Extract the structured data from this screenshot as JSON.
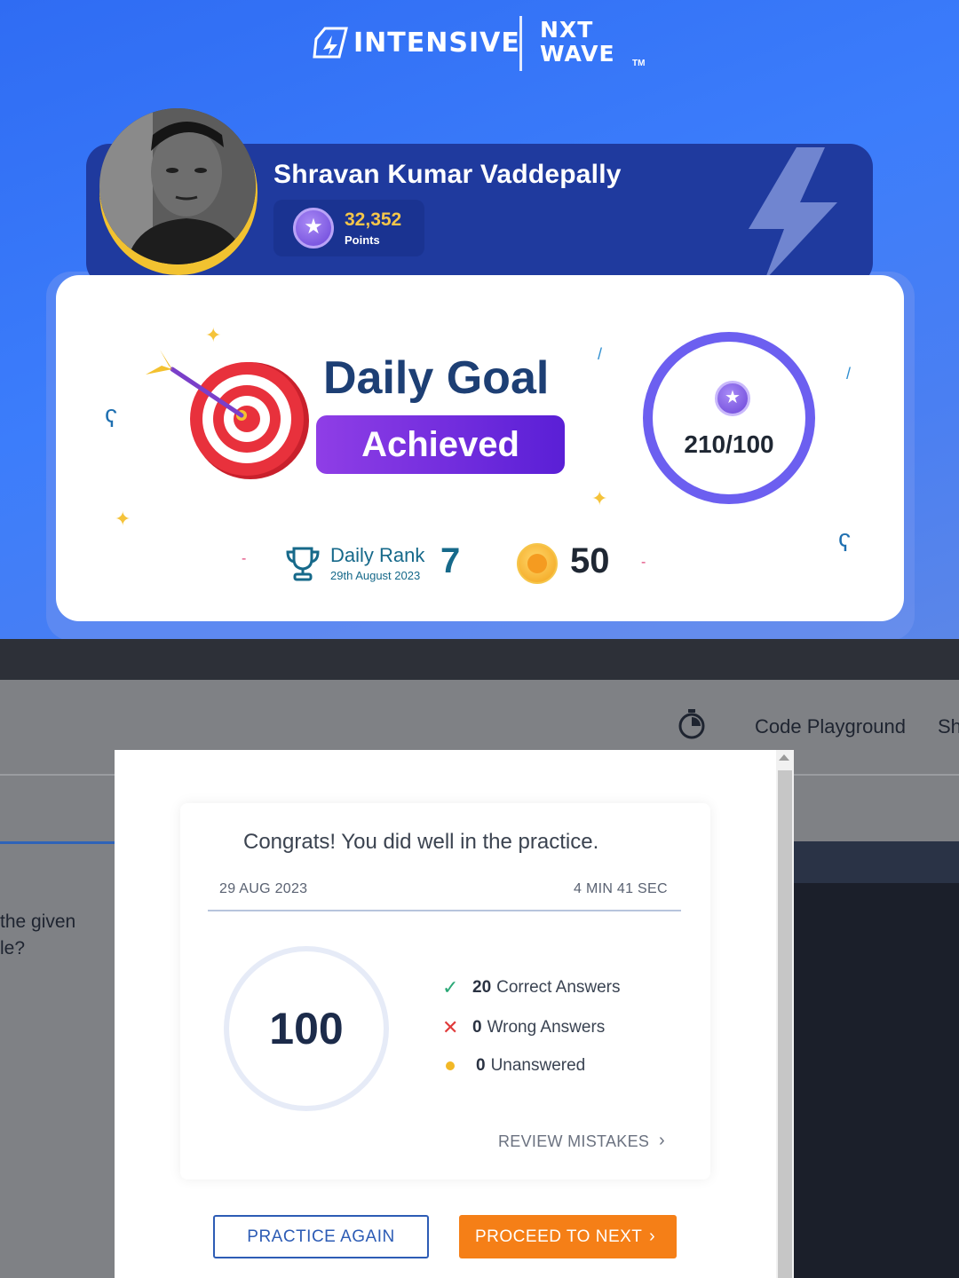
{
  "brand": {
    "left_name": "INTENSIVE",
    "right_line1": "NXT",
    "right_line2": "WAVE",
    "tm": "TM"
  },
  "profile": {
    "name": "Shravan Kumar Vaddepally",
    "points_value": "32,352",
    "points_label": "Points"
  },
  "daily_goal": {
    "title": "Daily Goal",
    "status": "Achieved",
    "progress": "210/100",
    "progress_fraction": 2.1,
    "rank_label": "Daily Rank",
    "rank_date": "29th August 2023",
    "rank_value": "7",
    "coins": "50"
  },
  "app": {
    "code_playground": "Code Playground",
    "partial_tab": "Sh",
    "question_line1": "the given",
    "question_line2": "le?"
  },
  "result": {
    "heading": "Congrats! You did well in the practice.",
    "date": "29 AUG 2023",
    "duration": "4 MIN 41 SEC",
    "score": "100",
    "correct_count": "20",
    "correct_label": "Correct Answers",
    "wrong_count": "0",
    "wrong_label": "Wrong Answers",
    "unanswered_count": "0",
    "unanswered_label": "Unanswered",
    "review_link": "REVIEW MISTAKES",
    "practice_again": "PRACTICE AGAIN",
    "proceed_next": "PROCEED TO NEXT"
  },
  "colors": {
    "hero_blue": "#3c7dfb",
    "profile_navy": "#1f3a9e",
    "achieved_purple": "#6d2ee0",
    "ring_purple": "#6c5ff0",
    "rank_teal": "#16698a",
    "proceed_orange": "#f57f17",
    "practice_blue": "#2d5cb5"
  },
  "icons": [
    "intensive-logo-icon",
    "lightning-bolt-icon",
    "star-badge-icon",
    "target-dart-icon",
    "trophy-icon",
    "coin-icon",
    "stopwatch-icon",
    "check-icon",
    "cross-icon",
    "dot-icon",
    "chevron-right-icon"
  ]
}
